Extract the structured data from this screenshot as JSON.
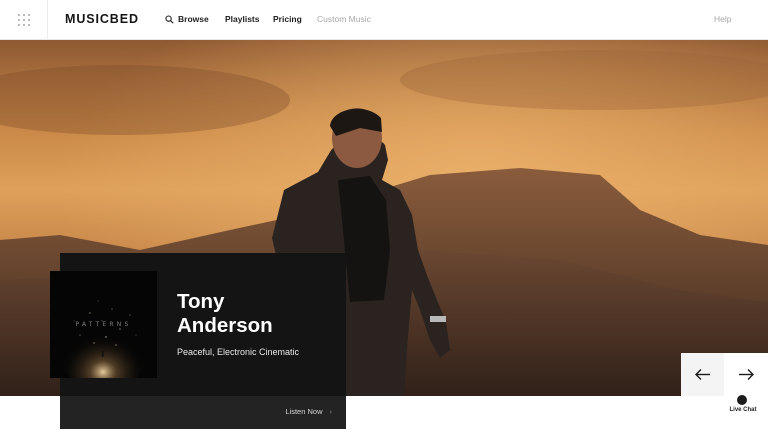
{
  "nav": {
    "brand": "MUSICBED",
    "links": [
      {
        "label": "Browse",
        "icon": "search-icon"
      },
      {
        "label": "Playlists"
      },
      {
        "label": "Pricing"
      },
      {
        "label": "Custom Music"
      }
    ],
    "help": "Help",
    "menu_icon": "grid-menu-icon"
  },
  "feature": {
    "artist_line1": "Tony",
    "artist_line2": "Anderson",
    "tags": "Peaceful, Electronic Cinematic",
    "album_art_text": "PATTERNS",
    "cta": "Listen Now",
    "cta_icon": "chevron-right-icon"
  },
  "carousel": {
    "prev_icon": "arrow-left-icon",
    "next_icon": "arrow-right-icon"
  },
  "chat": {
    "label": "Live Chat",
    "icon": "chat-bubble-icon"
  },
  "colors": {
    "card": "#141414",
    "card_footer": "#232323",
    "sky": "#dea05a"
  }
}
